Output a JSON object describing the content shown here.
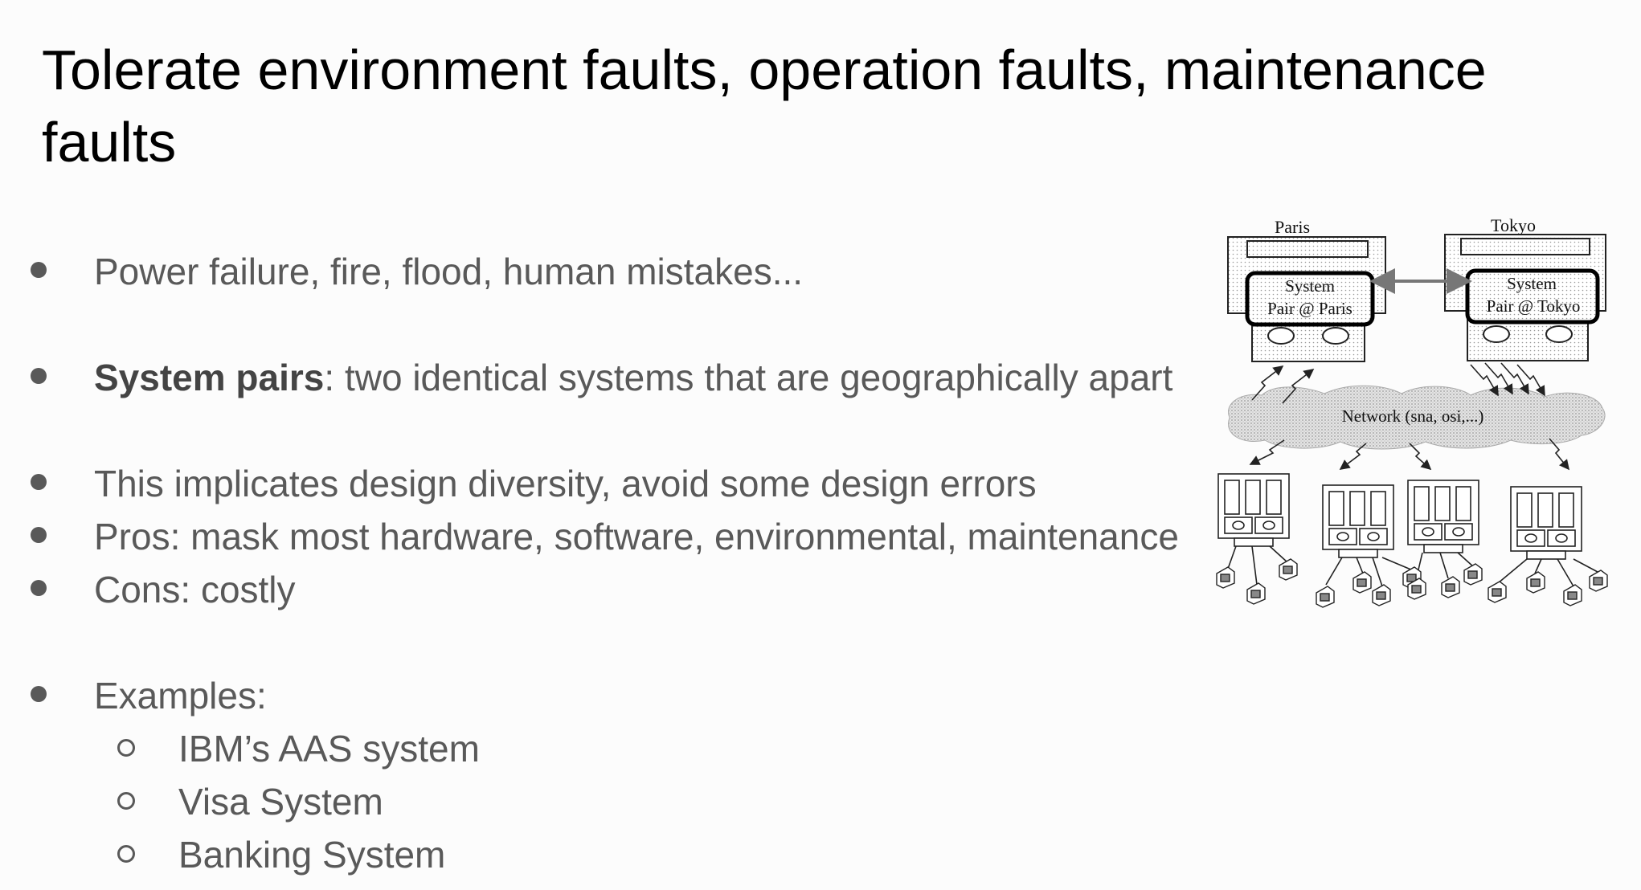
{
  "slide": {
    "title": "Tolerate environment faults, operation faults, maintenance faults",
    "bullets": [
      {
        "text": "Power failure, fire, flood, human mistakes..."
      },
      {
        "bold": "System pairs",
        "text": ": two identical systems that are geographically apart"
      },
      {
        "text": "This implicates design diversity, avoid some design errors"
      },
      {
        "text": "Pros: mask most hardware, software, environmental, maintenance"
      },
      {
        "text": "Cons: costly"
      },
      {
        "text": "Examples:"
      }
    ],
    "sub_bullets": [
      {
        "text": "IBM’s AAS system"
      },
      {
        "text": "Visa System"
      },
      {
        "text": "Banking System"
      }
    ]
  },
  "diagram": {
    "site_left": "Paris",
    "site_right": "Tokyo",
    "box_left_line1": "System",
    "box_left_line2": "Pair @ Paris",
    "box_right_line1": "System",
    "box_right_line2": "Pair @ Tokyo",
    "network_label": "Network (sna, osi,...)"
  }
}
